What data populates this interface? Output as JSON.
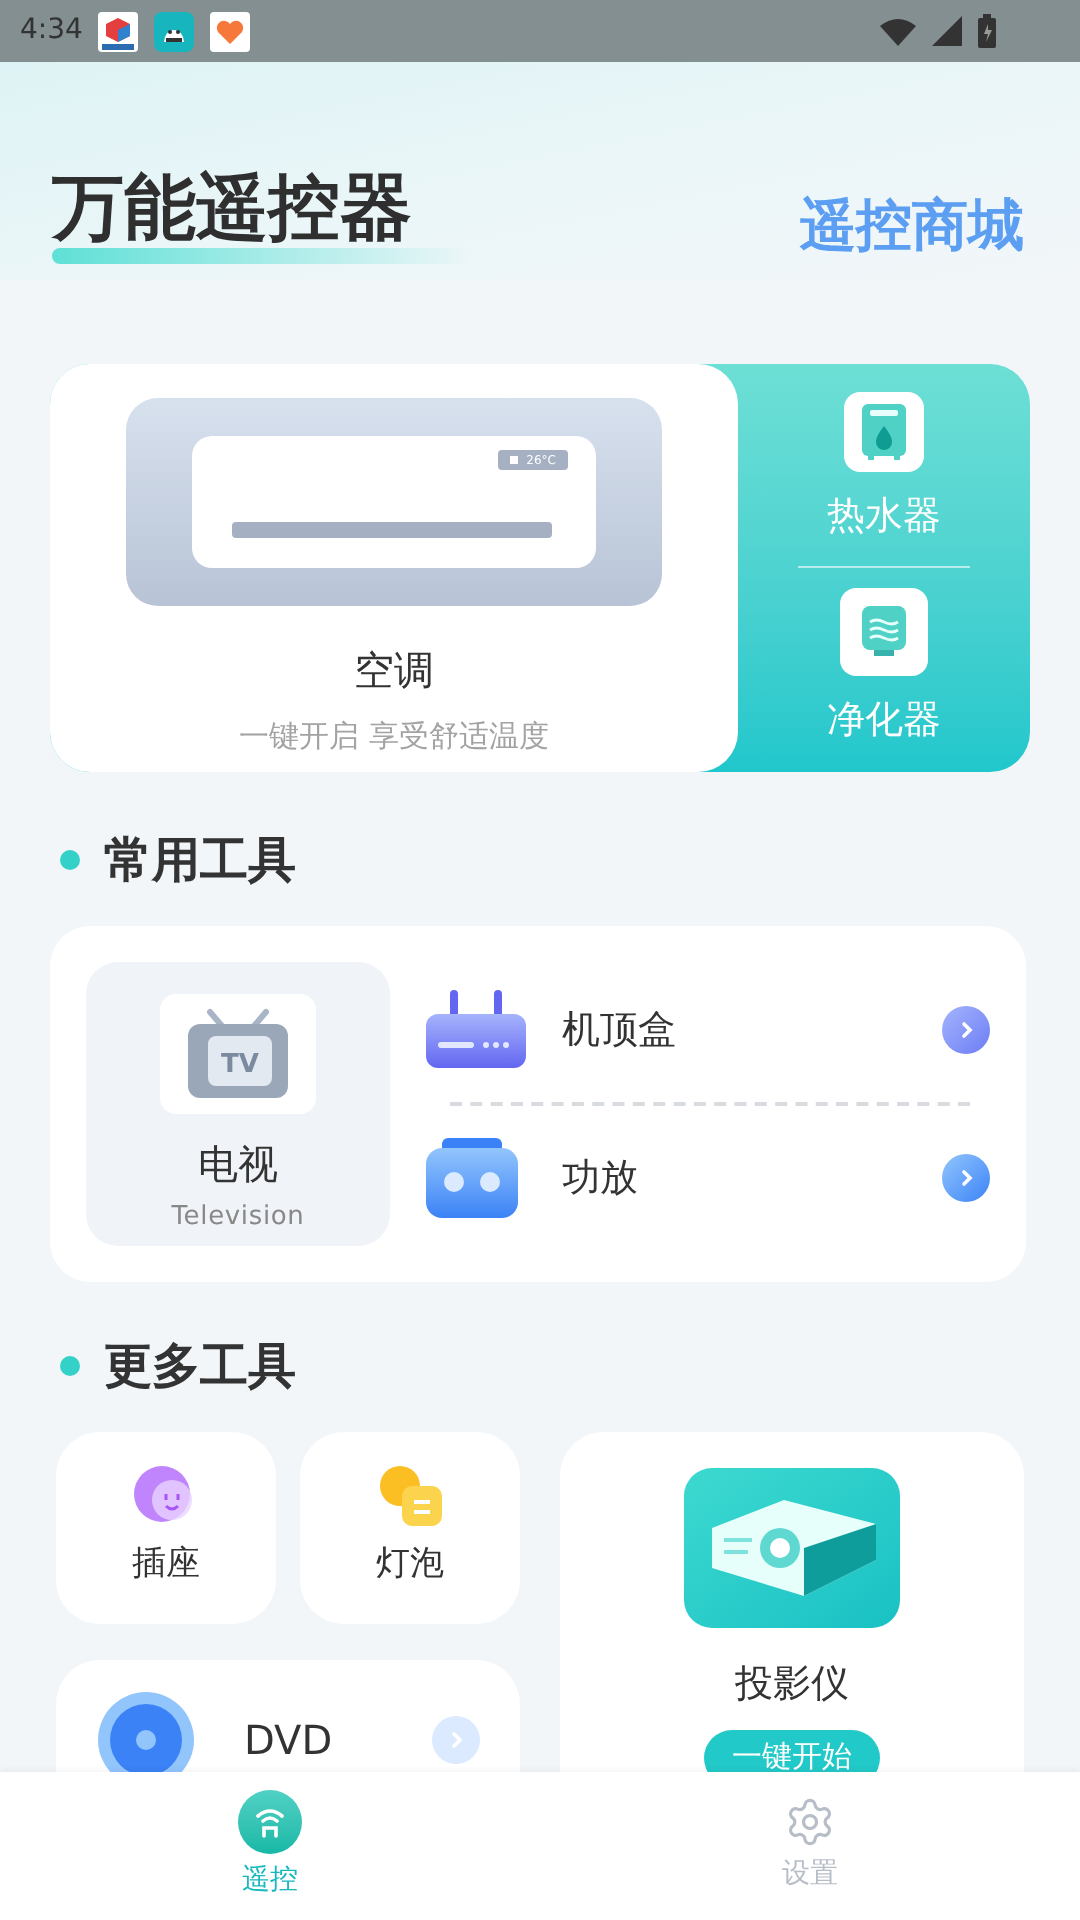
{
  "status_bar": {
    "time": "4:34"
  },
  "header": {
    "title": "万能遥控器",
    "store_link": "遥控商城"
  },
  "featured": {
    "main": {
      "title": "空调",
      "subtitle": "一键开启 享受舒适温度",
      "display": "26°C"
    },
    "side": [
      {
        "label": "热水器",
        "kind": "heater"
      },
      {
        "label": "净化器",
        "kind": "purifier"
      }
    ]
  },
  "common_tools": {
    "title": "常用工具",
    "tv": {
      "title": "电视",
      "subtitle": "Television",
      "badge": "TV"
    },
    "items": [
      {
        "label": "机顶盒",
        "kind": "settopbox"
      },
      {
        "label": "功放",
        "kind": "amplifier"
      }
    ]
  },
  "more_tools": {
    "title": "更多工具",
    "small": [
      {
        "label": "插座",
        "kind": "socket"
      },
      {
        "label": "灯泡",
        "kind": "bulb"
      }
    ],
    "dvd": {
      "label": "DVD"
    },
    "projector": {
      "label": "投影仪",
      "button": "一键开始"
    }
  },
  "bottom_nav": [
    {
      "label": "遥控",
      "kind": "remote",
      "selected": true
    },
    {
      "label": "设置",
      "kind": "settings",
      "selected": false
    }
  ]
}
